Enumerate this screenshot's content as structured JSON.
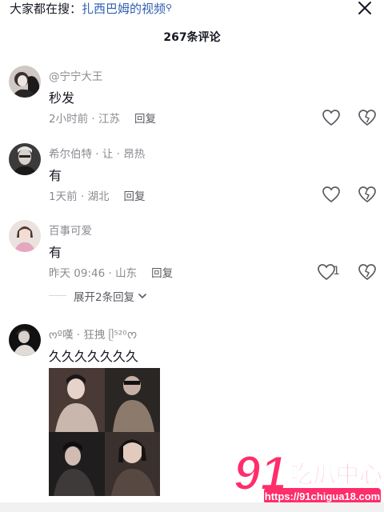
{
  "search": {
    "prefix": "大家都在搜：",
    "query": "扎西巴姆的视频"
  },
  "comment_count_label": "267条评论",
  "comments": [
    {
      "username": "@宁宁大王",
      "text": "秒发",
      "time_location": "2小时前 · 江苏",
      "reply_label": "回复",
      "like_count": ""
    },
    {
      "username": "希尔伯特 · 让 · 昂热",
      "text": "有",
      "time_location": "1天前 · 湖北",
      "reply_label": "回复",
      "like_count": ""
    },
    {
      "username": "百事可爱",
      "text": "有",
      "time_location": "昨天 09:46 · 山东",
      "reply_label": "回复",
      "like_count": "1"
    },
    {
      "username": "ოº嘆 · 狂拽 ᥫ⁵²⁰ᰔ",
      "text": "久久久久久久久",
      "time_location": "",
      "reply_label": "",
      "like_count": ""
    }
  ],
  "expand_replies_label": "展开2条回复",
  "watermark": {
    "number": "91",
    "brand": "吃瓜中心",
    "url": "https://91chigua18.com"
  },
  "colors": {
    "link_blue": "#2f5fb0",
    "muted_text": "#8a8b91",
    "watermark_pink": "#ff2d6a"
  }
}
